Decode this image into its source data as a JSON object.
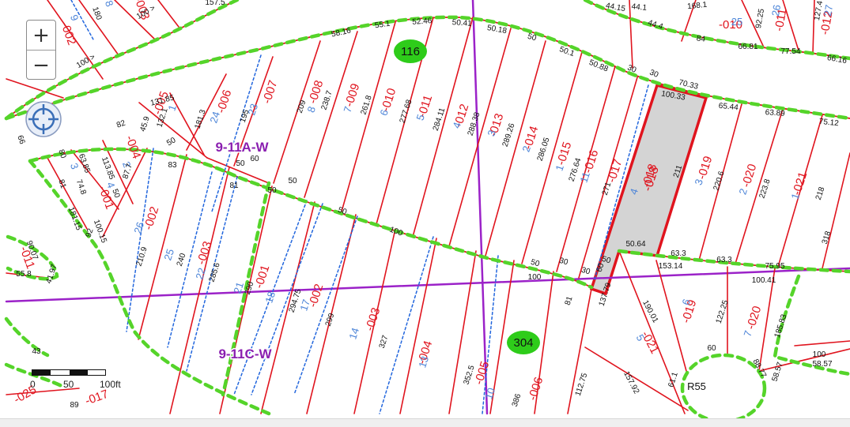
{
  "controls": {
    "zoom_in": "+",
    "zoom_out": "−",
    "locate_icon": "locate-crosshair-icon"
  },
  "scale_bar": {
    "labels": [
      "0",
      "50",
      "100ft"
    ]
  },
  "colors": {
    "parcel_line": "#e0141e",
    "easement": "#2266dd",
    "subdivision": "#55d42a",
    "grid_line": "#9b22c8",
    "selected_fill": "#d4d4d4",
    "selected_outline": "#e0141e",
    "parcel_id_text": "#e0141e",
    "sub_lot_text": "#4f86d8",
    "map_id_text": "#8a1fb0",
    "badge_fill": "#2ecc1a"
  },
  "map_ids": [
    {
      "text": "9-11A-W"
    },
    {
      "text": "9-11C-W"
    }
  ],
  "badges": [
    {
      "text": "116"
    },
    {
      "text": "304"
    }
  ],
  "road_label": "R55",
  "selected_parcel": {
    "id": "-018"
  },
  "parcel_labels": [
    "-002",
    "-003",
    "-005",
    "-006",
    "-007",
    "-008",
    "-009",
    "-010",
    "-011",
    "-012",
    "-013",
    "-014",
    "-015",
    "-016",
    "-017",
    "-018",
    "-019",
    "-020",
    "-021",
    "-004",
    "-001",
    "-002",
    "-003",
    "-001",
    "-002",
    "-003",
    "-004",
    "-005",
    "-006",
    "-019",
    "-020",
    "-021",
    "-011",
    "-025",
    "-017",
    "-010",
    "-011",
    "-012"
  ],
  "sub_lot_labels": [
    "9",
    "8",
    "1",
    "24",
    "23",
    "8",
    "7",
    "6",
    "5",
    "4",
    "3",
    "2",
    "1",
    "11",
    "4",
    "3",
    "2",
    "1",
    "26",
    "25",
    "22",
    "21",
    "17",
    "18",
    "14",
    "13",
    "10",
    "2",
    "3",
    "4",
    "5",
    "6",
    "7",
    "25",
    "26",
    "27"
  ],
  "dim_labels": [
    "180",
    "100 >",
    "100 >",
    "157.5",
    "58.16",
    "55.1",
    "52.46",
    "50.41",
    "50.18",
    "50",
    "50.1",
    "50.88",
    "30",
    "30",
    "70.33",
    "100.33",
    "65.44",
    "63.89",
    "75.12",
    "44.15",
    "44.1",
    "44.4",
    "84",
    "168.1",
    "66.81",
    "77.54",
    "66.16",
    "92.25",
    "127.4",
    "131.85",
    "132.1",
    "181.3",
    "195",
    "209",
    "238.7",
    "261.8",
    "277.68",
    "284.11",
    "288.38",
    "289.26",
    "286.05",
    "276.64",
    "271",
    "211",
    "220.6",
    "223.8",
    "218",
    "82",
    "45.9",
    "50",
    "83",
    "50",
    "60",
    "81",
    "50",
    "50",
    "50",
    "100",
    "50",
    "30",
    "30",
    "50",
    "60",
    "100",
    "81",
    "50.64",
    "63.3",
    "63.3",
    "153.14",
    "75.95",
    "100.41",
    "66",
    "80",
    "63.85",
    "113.85",
    "87.7",
    "74.8",
    "50",
    "81",
    "92",
    "100.15",
    "181.15",
    "90.07",
    "55.8",
    "41.97",
    "210.9",
    "240",
    "285.6",
    "290",
    "294.75",
    "299",
    "327",
    "352.5",
    "386",
    "112.75",
    "137.79",
    "190.01",
    "122.25",
    "185.83",
    "157.92",
    "61.1",
    "60",
    "88.77",
    "58.57",
    "58.57",
    "100",
    "318",
    "89",
    "43"
  ]
}
